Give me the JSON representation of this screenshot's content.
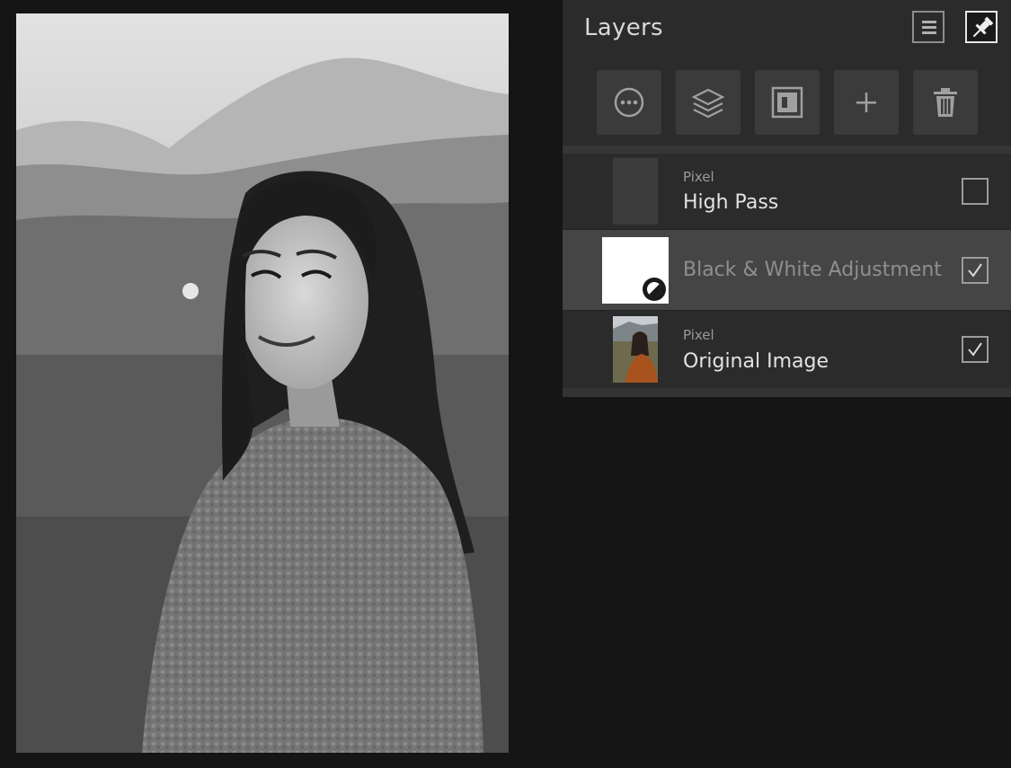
{
  "panel": {
    "title": "Layers",
    "header_buttons": {
      "menu": "menu-icon",
      "pin": "pin-icon"
    }
  },
  "toolbar": {
    "tools": [
      {
        "icon": "more-options-icon"
      },
      {
        "icon": "layer-stack-icon"
      },
      {
        "icon": "mask-icon"
      },
      {
        "icon": "add-icon"
      },
      {
        "icon": "trash-icon"
      }
    ]
  },
  "layers": [
    {
      "type": "Pixel",
      "name": "High Pass",
      "visible": false
    },
    {
      "type": "",
      "name": "Black & White Adjustment",
      "visible": true,
      "selected": true
    },
    {
      "type": "Pixel",
      "name": "Original Image",
      "visible": true
    }
  ],
  "colors": {
    "panel_bg": "#2b2b2b",
    "selected_row": "#454545",
    "workspace_bg": "#151515"
  }
}
